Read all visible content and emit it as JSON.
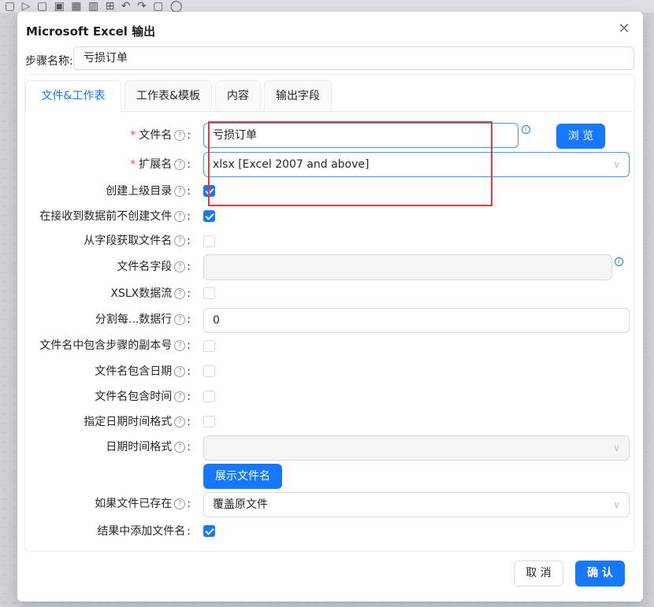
{
  "dialog": {
    "title": "Microsoft Excel 输出",
    "close_label": "✕"
  },
  "step": {
    "label": "步骤名称:",
    "value": "亏损订单"
  },
  "tabs": [
    {
      "label": "文件&工作表",
      "active": true
    },
    {
      "label": "工作表&模板",
      "active": false
    },
    {
      "label": "内容",
      "active": false
    },
    {
      "label": "输出字段",
      "active": false
    }
  ],
  "form": {
    "filename": {
      "label": "文件名",
      "value": "亏损订单",
      "required": true
    },
    "browse_button": "浏 览",
    "extension": {
      "label": "扩展名",
      "value": "xlsx [Excel 2007 and above]",
      "required": true
    },
    "create_parent_dir": {
      "label": "创建上级目录",
      "checked": true
    },
    "no_create_before_data": {
      "label": "在接收到数据前不创建文件",
      "checked": true
    },
    "filename_from_field": {
      "label": "从字段获取文件名",
      "checked": false
    },
    "filename_field": {
      "label": "文件名字段",
      "value": ""
    },
    "xslx_stream": {
      "label": "XSLX数据流",
      "checked": false
    },
    "split_rows": {
      "label": "分割每...数据行",
      "value": "0"
    },
    "include_step_copy": {
      "label": "文件名中包含步骤的副本号",
      "checked": false
    },
    "include_date": {
      "label": "文件名包含日期",
      "checked": false
    },
    "include_time": {
      "label": "文件名包含时间",
      "checked": false
    },
    "specify_datetime_format": {
      "label": "指定日期时间格式",
      "checked": false
    },
    "datetime_format": {
      "label": "日期时间格式",
      "value": ""
    },
    "show_filename_button": "展示文件名",
    "if_file_exists": {
      "label": "如果文件已存在",
      "value": "覆盖原文件"
    },
    "add_filename_to_result": {
      "label": "结果中添加文件名",
      "checked": true
    }
  },
  "footer": {
    "cancel": "取 消",
    "confirm": "确 认"
  },
  "icons": {
    "help": "?",
    "info": "i",
    "chevron": "∨"
  },
  "colors": {
    "primary": "#1677ff",
    "highlight_box": "#e0393e",
    "required": "#ff4d4f"
  }
}
